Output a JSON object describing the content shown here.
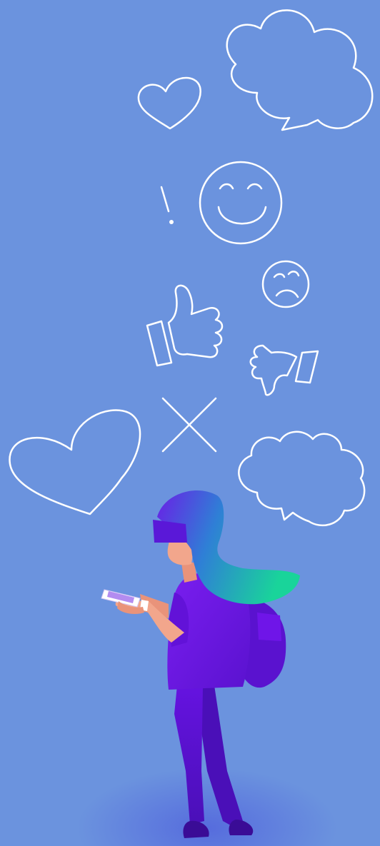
{
  "scene": {
    "background_color": "#6b93de",
    "floor_glow_color": "#4b47d6",
    "icon_stroke_color": "#ffffff",
    "icons": [
      "speech-cloud-icon",
      "heart-icon",
      "exclamation-icon",
      "smiley-icon",
      "sad-face-icon",
      "thumbs-up-icon",
      "thumbs-down-icon",
      "cross-icon",
      "heart-icon",
      "speech-cloud-icon"
    ],
    "person": {
      "hair_gradient": [
        "#6a1fe6",
        "#19d49a"
      ],
      "clothing_color": "#6f15e8",
      "skin_color": "#f2a68c"
    }
  }
}
